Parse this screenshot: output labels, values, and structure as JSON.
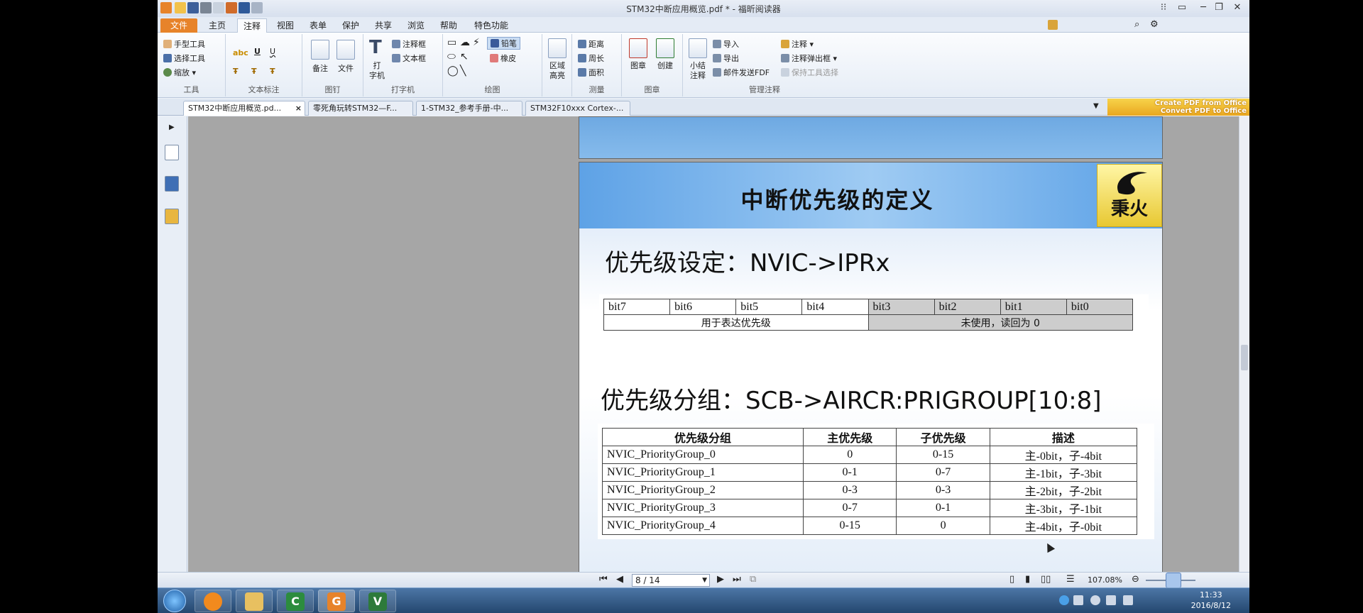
{
  "window": {
    "title": "STM32中断应用概览.pdf * - 福昕阅读器",
    "controls": [
      "⁝⁝",
      "▭",
      "─",
      "❐",
      "✕"
    ]
  },
  "menu": {
    "file": "文件",
    "tabs": [
      "主页",
      "注释",
      "视图",
      "表单",
      "保护",
      "共享",
      "浏览",
      "帮助",
      "特色功能"
    ],
    "active": "注释",
    "search_placeholder": "查找"
  },
  "ribbon": {
    "tools": {
      "label": "工具",
      "items": [
        "手型工具",
        "选择工具",
        "缩放"
      ]
    },
    "text_markup": {
      "label": "文本标注"
    },
    "pin": {
      "label": "图钉",
      "items": [
        "备注",
        "文件"
      ]
    },
    "typewriter": {
      "label": "打字机",
      "big": "打\n字机",
      "items": [
        "注释框",
        "文本框"
      ]
    },
    "drawing": {
      "label": "绘图",
      "items": [
        "铅笔",
        "橡皮"
      ]
    },
    "area_highlight": {
      "label": "区域\n高亮"
    },
    "measure": {
      "label": "测量",
      "items": [
        "距离",
        "周长",
        "面积"
      ]
    },
    "stamp": {
      "label": "图章",
      "items": [
        "图章",
        "创建"
      ]
    },
    "manage": {
      "label": "管理注释",
      "summary": "小结\n注释",
      "items": [
        "导入",
        "导出",
        "邮件发送FDF",
        "注释",
        "注释弹出框",
        "保持工具选择"
      ]
    }
  },
  "doc_tabs": [
    "STM32中断应用概览.pd...",
    "零死角玩转STM32—F...",
    "1-STM32_参考手册-中...",
    "STM32F10xxx Cortex-..."
  ],
  "create_pdf": {
    "line1": "Create PDF from Office",
    "line2": "Convert PDF to Office"
  },
  "slide": {
    "title": "中断优先级的定义",
    "logo_text": "秉火",
    "heading1": "优先级设定：NVIC->IPRx",
    "bits": [
      "bit7",
      "bit6",
      "bit5",
      "bit4",
      "bit3",
      "bit2",
      "bit1",
      "bit0"
    ],
    "used_label": "用于表达优先级",
    "unused_label": "未使用，读回为 0",
    "heading2": "优先级分组：SCB->AIRCR:PRIGROUP[10:8]",
    "group_table": {
      "headers": [
        "优先级分组",
        "主优先级",
        "子优先级",
        "描述"
      ],
      "rows": [
        [
          "NVIC_PriorityGroup_0",
          "0",
          "0-15",
          "主-0bit，子-4bit"
        ],
        [
          "NVIC_PriorityGroup_1",
          "0-1",
          "0-7",
          "主-1bit，子-3bit"
        ],
        [
          "NVIC_PriorityGroup_2",
          "0-3",
          "0-3",
          "主-2bit，子-2bit"
        ],
        [
          "NVIC_PriorityGroup_3",
          "0-7",
          "0-1",
          "主-3bit，子-1bit"
        ],
        [
          "NVIC_PriorityGroup_4",
          "0-15",
          "0",
          "主-4bit，子-0bit"
        ]
      ]
    }
  },
  "status": {
    "page": "8 / 14",
    "zoom": "107.08%"
  },
  "clock": {
    "time": "11:33",
    "date": "2016/8/12"
  }
}
